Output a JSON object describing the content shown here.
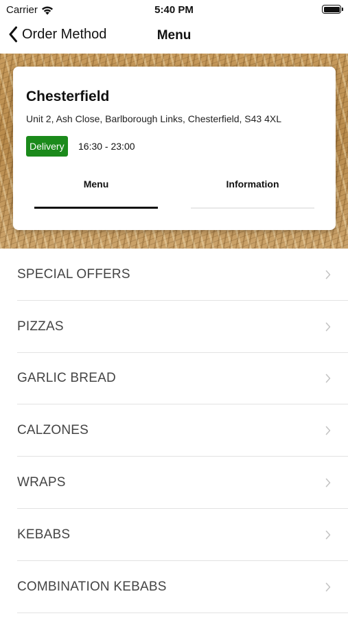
{
  "status_bar": {
    "carrier": "Carrier",
    "time": "5:40 PM"
  },
  "nav": {
    "back_label": "Order Method",
    "title": "Menu"
  },
  "store": {
    "name": "Chesterfield",
    "address": "Unit 2, Ash Close, Barlborough Links, Chesterfield, S43 4XL",
    "badge": "Delivery",
    "hours": "16:30 - 23:00",
    "badge_color": "#1b8a1b"
  },
  "tabs": [
    {
      "label": "Menu",
      "active": true
    },
    {
      "label": "Information",
      "active": false
    }
  ],
  "categories": [
    {
      "label": "SPECIAL OFFERS"
    },
    {
      "label": "PIZZAS"
    },
    {
      "label": "GARLIC BREAD"
    },
    {
      "label": "CALZONES"
    },
    {
      "label": "WRAPS"
    },
    {
      "label": "KEBABS"
    },
    {
      "label": "COMBINATION KEBABS"
    }
  ],
  "icons": {
    "back": "chevron-left-icon",
    "row": "chevron-right-icon",
    "wifi": "wifi-icon",
    "battery": "battery-icon"
  }
}
